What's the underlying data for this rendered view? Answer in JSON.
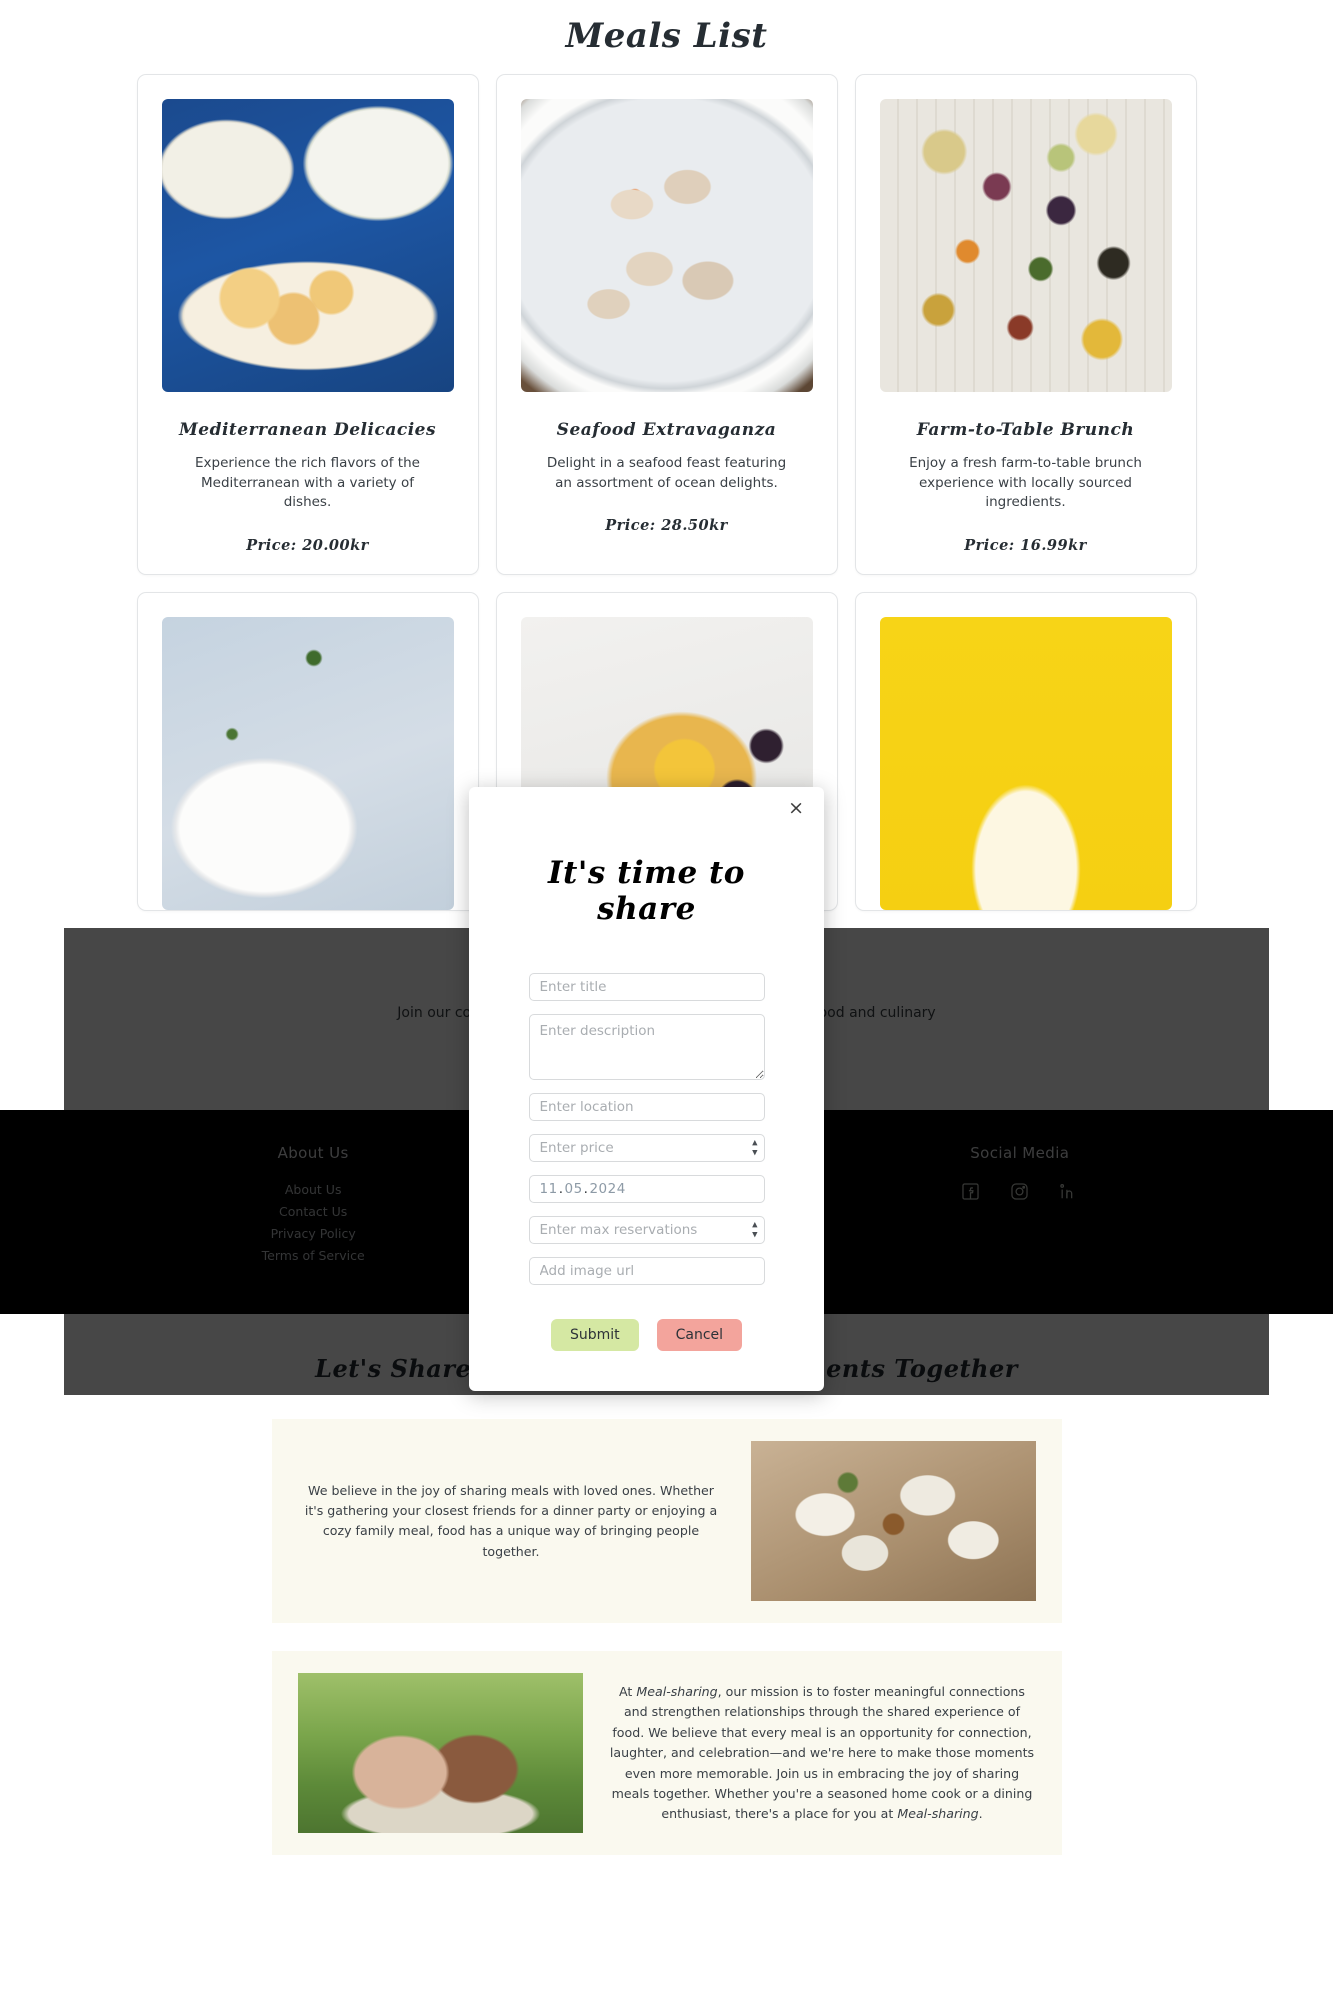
{
  "page": {
    "title": "Meals List"
  },
  "meals": [
    {
      "name": "Mediterranean Delicacies",
      "description": "Experience the rich flavors of the Mediterranean with a variety of dishes.",
      "price": "Price: 20.00kr",
      "image": "mediterranean-dishes-photo"
    },
    {
      "name": "Seafood Extravaganza",
      "description": "Delight in a seafood feast featuring an assortment of ocean delights.",
      "price": "Price: 28.50kr",
      "image": "oysters-on-ice-photo"
    },
    {
      "name": "Farm-to-Table Brunch",
      "description": "Enjoy a fresh farm-to-table brunch experience with locally sourced ingredients.",
      "price": "Price: 16.99kr",
      "image": "grazing-board-photo"
    },
    {
      "name": "",
      "description": "",
      "price": "",
      "image": "soup-bowl-photo"
    },
    {
      "name": "",
      "description": "",
      "price": "",
      "image": "citrus-dessert-photo"
    },
    {
      "name": "",
      "description": "",
      "price": "",
      "image": "yellow-background-photo"
    }
  ],
  "join": {
    "text": "Join our community, share your favourite meals, and enjoy food and culinary adventures with friends."
  },
  "modal": {
    "close_label": "×",
    "title": "It's time to share",
    "fields": {
      "title_placeholder": "Enter title",
      "title_value": "",
      "description_placeholder": "Enter description",
      "description_value": "",
      "location_placeholder": "Enter location",
      "location_value": "",
      "price_placeholder": "Enter price",
      "price_value": "",
      "date_day": "11",
      "date_month": "05",
      "date_year": "2024",
      "date_separator": ".",
      "reservations_placeholder": "Enter max reservations",
      "reservations_value": "",
      "image_url_placeholder": "Add image url",
      "image_url_value": ""
    },
    "submit_label": "Submit",
    "cancel_label": "Cancel"
  },
  "footer": {
    "about": {
      "heading": "About Us",
      "links": [
        "About Us",
        "Contact Us",
        "Privacy Policy",
        "Terms of Service"
      ]
    },
    "social": {
      "heading": "Social Media",
      "icons": [
        "facebook-icon",
        "instagram-icon",
        "linkedin-icon"
      ]
    }
  },
  "share_section": {
    "heading": "Let's Share Meals, Stories, and Moments Together",
    "block_one": {
      "text": "We believe in the joy of sharing meals with loved ones. Whether it's gathering your closest friends for a dinner party or enjoying a cozy family meal, food has a unique way of bringing people together.",
      "image": "shared-dinner-table-photo"
    },
    "block_two": {
      "text_part_1": "At ",
      "brand_1": "Meal-sharing",
      "text_part_2": ", our mission is to foster meaningful connections and strengthen relationships through the shared experience of food. We believe that every meal is an opportunity for connection, laughter, and celebration—and we're here to make those moments even more memorable. Join us in embracing the joy of sharing meals together. Whether you're a seasoned home cook or a dining enthusiast, there's a place for you at ",
      "brand_2": "Meal-sharing",
      "text_part_3": ".",
      "image": "friends-picnic-photo"
    }
  },
  "colors": {
    "submit_green": "#d5e8a3",
    "cancel_salmon": "#f3a49c",
    "footer_black": "#000000",
    "band_cream": "#faf9ef",
    "heading_dark": "#262d33"
  }
}
